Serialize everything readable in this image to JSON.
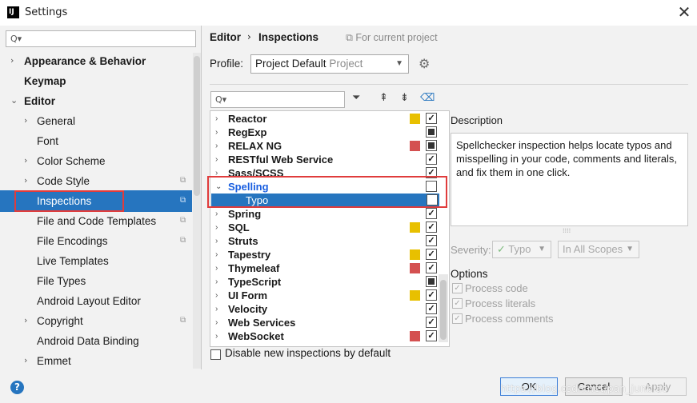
{
  "window": {
    "title": "Settings",
    "app_icon_text": "IJ",
    "close_glyph": "✕"
  },
  "sidebar": {
    "search_placeholder": "Q▾",
    "items": [
      {
        "label": "Appearance & Behavior",
        "bold": true,
        "chevron": "›"
      },
      {
        "label": "Keymap",
        "bold": true
      },
      {
        "label": "Editor",
        "bold": true,
        "chevron": "⌄"
      },
      {
        "label": "General",
        "chevron": "›"
      },
      {
        "label": "Font"
      },
      {
        "label": "Color Scheme",
        "chevron": "›"
      },
      {
        "label": "Code Style",
        "chevron": "›",
        "project_icon": true
      },
      {
        "label": "Inspections",
        "selected": true,
        "project_icon": true
      },
      {
        "label": "File and Code Templates",
        "project_icon": true
      },
      {
        "label": "File Encodings",
        "project_icon": true
      },
      {
        "label": "Live Templates"
      },
      {
        "label": "File Types"
      },
      {
        "label": "Android Layout Editor"
      },
      {
        "label": "Copyright",
        "chevron": "›",
        "project_icon": true
      },
      {
        "label": "Android Data Binding"
      },
      {
        "label": "Emmet",
        "chevron": "›"
      }
    ]
  },
  "breadcrumb": {
    "editor": "Editor",
    "separator": "›",
    "inspections": "Inspections",
    "scope": "For current project",
    "scope_icon": "⧉"
  },
  "profile": {
    "label": "Profile:",
    "value": "Project Default",
    "sub": "Project",
    "gear_icon": "gear-icon"
  },
  "toolbar": {
    "filter": "⏷",
    "expand": "⇞",
    "collapse": "⇟",
    "eraser": "⌫"
  },
  "inspections": [
    {
      "label": "Reactor",
      "swatch": "#e8c000",
      "check": "checked"
    },
    {
      "label": "RegExp",
      "swatch": "",
      "check": "mixed"
    },
    {
      "label": "RELAX NG",
      "swatch": "#d45050",
      "check": "mixed"
    },
    {
      "label": "RESTful Web Service",
      "swatch": "",
      "check": "checked"
    },
    {
      "label": "Sass/SCSS",
      "swatch": "",
      "check": "checked"
    },
    {
      "label": "Spelling",
      "swatch": "",
      "check": "empty",
      "expanded": true,
      "highlight": true
    },
    {
      "label": "Typo",
      "swatch": "",
      "check": "empty",
      "child": true,
      "selected": true
    },
    {
      "label": "Spring",
      "swatch": "",
      "check": "checked"
    },
    {
      "label": "SQL",
      "swatch": "#e8c000",
      "check": "checked"
    },
    {
      "label": "Struts",
      "swatch": "",
      "check": "checked"
    },
    {
      "label": "Tapestry",
      "swatch": "#e8c000",
      "check": "checked"
    },
    {
      "label": "Thymeleaf",
      "swatch": "#d45050",
      "check": "checked"
    },
    {
      "label": "TypeScript",
      "swatch": "",
      "check": "mixed"
    },
    {
      "label": "UI Form",
      "swatch": "#e8c000",
      "check": "checked"
    },
    {
      "label": "Velocity",
      "swatch": "",
      "check": "checked"
    },
    {
      "label": "Web Services",
      "swatch": "",
      "check": "checked"
    },
    {
      "label": "WebSocket",
      "swatch": "#d45050",
      "check": "checked"
    }
  ],
  "description": {
    "title": "Description",
    "text": "Spellchecker inspection helps locate typos and misspelling in your code, comments and literals, and fix them in one click."
  },
  "severity": {
    "label": "Severity:",
    "value": "Typo",
    "scope": "In All Scopes"
  },
  "options": {
    "title": "Options",
    "items": [
      "Process code",
      "Process literals",
      "Process comments"
    ]
  },
  "disable_new": "Disable new inspections by default",
  "buttons": {
    "help": "?",
    "ok": "OK",
    "cancel": "Cancel",
    "apply": "Apply"
  },
  "watermark": "https://blog.csdn.net/pan_junbiao"
}
